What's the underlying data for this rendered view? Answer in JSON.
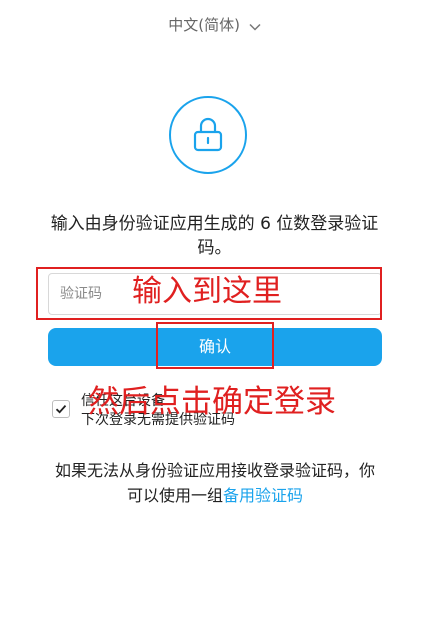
{
  "language_selector": {
    "label": "中文(简体)",
    "icon": "chevron-down-icon"
  },
  "lock_icon": "lock-icon",
  "instruction": "输入由身份验证应用生成的 6 位数登录验证码。",
  "code_input": {
    "placeholder": "验证码",
    "value": ""
  },
  "confirm_button": {
    "label": "确认"
  },
  "trust_device": {
    "checked": true,
    "line1": "信任这台设备",
    "line2": "下次登录无需提供验证码"
  },
  "fallback": {
    "text": "如果无法从身份验证应用接收登录验证码，你可以使用一组",
    "link": "备用验证码"
  },
  "annotations": {
    "input_note": "输入到这里",
    "click_note": "然后点击确定登录",
    "color": "#e02020"
  },
  "accent_color": "#1aa3ec"
}
